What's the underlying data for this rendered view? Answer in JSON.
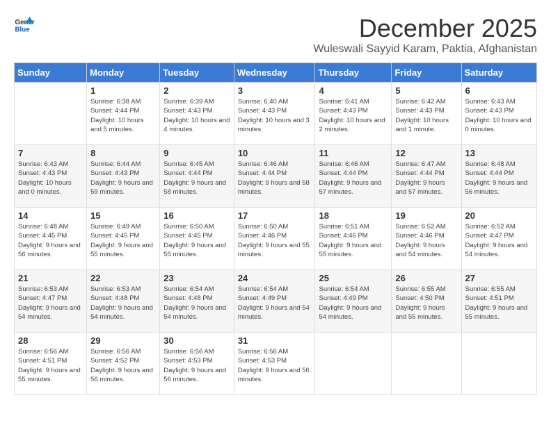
{
  "logo": {
    "text_general": "General",
    "text_blue": "Blue"
  },
  "title": "December 2025",
  "location": "Wuleswali Sayyid Karam, Paktia, Afghanistan",
  "days_of_week": [
    "Sunday",
    "Monday",
    "Tuesday",
    "Wednesday",
    "Thursday",
    "Friday",
    "Saturday"
  ],
  "weeks": [
    [
      {
        "day": "",
        "sunrise": "",
        "sunset": "",
        "daylight": ""
      },
      {
        "day": "1",
        "sunrise": "Sunrise: 6:38 AM",
        "sunset": "Sunset: 4:44 PM",
        "daylight": "Daylight: 10 hours and 5 minutes."
      },
      {
        "day": "2",
        "sunrise": "Sunrise: 6:39 AM",
        "sunset": "Sunset: 4:43 PM",
        "daylight": "Daylight: 10 hours and 4 minutes."
      },
      {
        "day": "3",
        "sunrise": "Sunrise: 6:40 AM",
        "sunset": "Sunset: 4:43 PM",
        "daylight": "Daylight: 10 hours and 3 minutes."
      },
      {
        "day": "4",
        "sunrise": "Sunrise: 6:41 AM",
        "sunset": "Sunset: 4:43 PM",
        "daylight": "Daylight: 10 hours and 2 minutes."
      },
      {
        "day": "5",
        "sunrise": "Sunrise: 6:42 AM",
        "sunset": "Sunset: 4:43 PM",
        "daylight": "Daylight: 10 hours and 1 minute."
      },
      {
        "day": "6",
        "sunrise": "Sunrise: 6:43 AM",
        "sunset": "Sunset: 4:43 PM",
        "daylight": "Daylight: 10 hours and 0 minutes."
      }
    ],
    [
      {
        "day": "7",
        "sunrise": "Sunrise: 6:43 AM",
        "sunset": "Sunset: 4:43 PM",
        "daylight": "Daylight: 10 hours and 0 minutes."
      },
      {
        "day": "8",
        "sunrise": "Sunrise: 6:44 AM",
        "sunset": "Sunset: 4:43 PM",
        "daylight": "Daylight: 9 hours and 59 minutes."
      },
      {
        "day": "9",
        "sunrise": "Sunrise: 6:45 AM",
        "sunset": "Sunset: 4:44 PM",
        "daylight": "Daylight: 9 hours and 58 minutes."
      },
      {
        "day": "10",
        "sunrise": "Sunrise: 6:46 AM",
        "sunset": "Sunset: 4:44 PM",
        "daylight": "Daylight: 9 hours and 58 minutes."
      },
      {
        "day": "11",
        "sunrise": "Sunrise: 6:46 AM",
        "sunset": "Sunset: 4:44 PM",
        "daylight": "Daylight: 9 hours and 57 minutes."
      },
      {
        "day": "12",
        "sunrise": "Sunrise: 6:47 AM",
        "sunset": "Sunset: 4:44 PM",
        "daylight": "Daylight: 9 hours and 57 minutes."
      },
      {
        "day": "13",
        "sunrise": "Sunrise: 6:48 AM",
        "sunset": "Sunset: 4:44 PM",
        "daylight": "Daylight: 9 hours and 56 minutes."
      }
    ],
    [
      {
        "day": "14",
        "sunrise": "Sunrise: 6:48 AM",
        "sunset": "Sunset: 4:45 PM",
        "daylight": "Daylight: 9 hours and 56 minutes."
      },
      {
        "day": "15",
        "sunrise": "Sunrise: 6:49 AM",
        "sunset": "Sunset: 4:45 PM",
        "daylight": "Daylight: 9 hours and 55 minutes."
      },
      {
        "day": "16",
        "sunrise": "Sunrise: 6:50 AM",
        "sunset": "Sunset: 4:45 PM",
        "daylight": "Daylight: 9 hours and 55 minutes."
      },
      {
        "day": "17",
        "sunrise": "Sunrise: 6:50 AM",
        "sunset": "Sunset: 4:46 PM",
        "daylight": "Daylight: 9 hours and 55 minutes."
      },
      {
        "day": "18",
        "sunrise": "Sunrise: 6:51 AM",
        "sunset": "Sunset: 4:46 PM",
        "daylight": "Daylight: 9 hours and 55 minutes."
      },
      {
        "day": "19",
        "sunrise": "Sunrise: 6:52 AM",
        "sunset": "Sunset: 4:46 PM",
        "daylight": "Daylight: 9 hours and 54 minutes."
      },
      {
        "day": "20",
        "sunrise": "Sunrise: 6:52 AM",
        "sunset": "Sunset: 4:47 PM",
        "daylight": "Daylight: 9 hours and 54 minutes."
      }
    ],
    [
      {
        "day": "21",
        "sunrise": "Sunrise: 6:53 AM",
        "sunset": "Sunset: 4:47 PM",
        "daylight": "Daylight: 9 hours and 54 minutes."
      },
      {
        "day": "22",
        "sunrise": "Sunrise: 6:53 AM",
        "sunset": "Sunset: 4:48 PM",
        "daylight": "Daylight: 9 hours and 54 minutes."
      },
      {
        "day": "23",
        "sunrise": "Sunrise: 6:54 AM",
        "sunset": "Sunset: 4:48 PM",
        "daylight": "Daylight: 9 hours and 54 minutes."
      },
      {
        "day": "24",
        "sunrise": "Sunrise: 6:54 AM",
        "sunset": "Sunset: 4:49 PM",
        "daylight": "Daylight: 9 hours and 54 minutes."
      },
      {
        "day": "25",
        "sunrise": "Sunrise: 6:54 AM",
        "sunset": "Sunset: 4:49 PM",
        "daylight": "Daylight: 9 hours and 54 minutes."
      },
      {
        "day": "26",
        "sunrise": "Sunrise: 6:55 AM",
        "sunset": "Sunset: 4:50 PM",
        "daylight": "Daylight: 9 hours and 55 minutes."
      },
      {
        "day": "27",
        "sunrise": "Sunrise: 6:55 AM",
        "sunset": "Sunset: 4:51 PM",
        "daylight": "Daylight: 9 hours and 55 minutes."
      }
    ],
    [
      {
        "day": "28",
        "sunrise": "Sunrise: 6:56 AM",
        "sunset": "Sunset: 4:51 PM",
        "daylight": "Daylight: 9 hours and 55 minutes."
      },
      {
        "day": "29",
        "sunrise": "Sunrise: 6:56 AM",
        "sunset": "Sunset: 4:52 PM",
        "daylight": "Daylight: 9 hours and 56 minutes."
      },
      {
        "day": "30",
        "sunrise": "Sunrise: 6:56 AM",
        "sunset": "Sunset: 4:53 PM",
        "daylight": "Daylight: 9 hours and 56 minutes."
      },
      {
        "day": "31",
        "sunrise": "Sunrise: 6:56 AM",
        "sunset": "Sunset: 4:53 PM",
        "daylight": "Daylight: 9 hours and 56 minutes."
      },
      {
        "day": "",
        "sunrise": "",
        "sunset": "",
        "daylight": ""
      },
      {
        "day": "",
        "sunrise": "",
        "sunset": "",
        "daylight": ""
      },
      {
        "day": "",
        "sunrise": "",
        "sunset": "",
        "daylight": ""
      }
    ]
  ]
}
